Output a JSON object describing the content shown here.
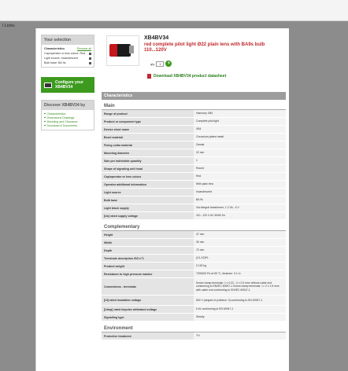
{
  "top_links": "l Links",
  "selection": {
    "title": "Your selection",
    "header_label": "Characteristics",
    "remove_all": "Remove all",
    "items": [
      "Cap/operator or lens colour: Red",
      "Light source: Incandescent",
      "Bulb base: BA 9s"
    ]
  },
  "config_button": "Configure your XB4BV34",
  "discover": {
    "title": "Discover XB4BV34 by",
    "links": [
      "Characteristics",
      "Dimensions Drawings",
      "Mounting and Clearance",
      "Download & Documents"
    ]
  },
  "product": {
    "name": "XB4BV34",
    "description": "red complete pilot light Ø22 plain lens with BA9s bulb 110...120V",
    "qty_label": "qty",
    "qty_value": "1",
    "add_symbol": "+",
    "download_text": "Download XB4BV34 product datasheet"
  },
  "specs": {
    "header": "Characteristics",
    "sections": [
      {
        "title": "Main",
        "rows": [
          {
            "label": "Range of product",
            "value": "Harmony XB4"
          },
          {
            "label": "Product or component type",
            "value": "Complete pilot light"
          },
          {
            "label": "Device short name",
            "value": "XB4"
          },
          {
            "label": "Bezel material",
            "value": "Chromium plated metal"
          },
          {
            "label": "Fixing collar material",
            "value": "Zamak"
          },
          {
            "label": "Mounting diameter",
            "value": "22 mm"
          },
          {
            "label": "Sale per indivisible quantity",
            "value": "1"
          },
          {
            "label": "Shape of signaling unit head",
            "value": "Round"
          },
          {
            "label": "Cap/operator or lens colour",
            "value": "Red"
          },
          {
            "label": "Operator additional information",
            "value": "With plain lens"
          },
          {
            "label": "Light source",
            "value": "Incandescent"
          },
          {
            "label": "Bulb base",
            "value": "BA 9s"
          },
          {
            "label": "Light block supply",
            "value": "Via integral transformer, 1.2 VA - 6 V"
          },
          {
            "label": "[Us] rated supply voltage",
            "value": "110...120 V AC 50/60 Hz"
          }
        ]
      },
      {
        "title": "Complementary",
        "rows": [
          {
            "label": "Height",
            "value": "47 mm"
          },
          {
            "label": "Width",
            "value": "30 mm"
          },
          {
            "label": "Depth",
            "value": "70 mm"
          },
          {
            "label": "Terminals description ISO n°1",
            "value": "(X1-X2)PL"
          },
          {
            "label": "Product weight",
            "value": "0.152 kg"
          },
          {
            "label": "Resistance to high pressure washer",
            "value": "7000000 Pa at 55 °C, distance: 0.1 m"
          },
          {
            "label": "Connections - terminals",
            "value": "Screw clamp terminals: 1 x 0.22...2 x 2.5 mm² without cable end conforming to EN/IEC 60947-1 Screw clamp terminals: <= 2 x 1.5 mm² with cable end conforming to EN/IEC 60947-1"
          },
          {
            "label": "[Ui] rated insulation voltage",
            "value": "600 V (degree of pollution: 3) conforming to EN 60947-1"
          },
          {
            "label": "[Uimp] rated impulse withstand voltage",
            "value": "6 kV conforming to EN 60947-1"
          },
          {
            "label": "Signalling type",
            "value": "Steady"
          }
        ]
      },
      {
        "title": "Environment",
        "rows": [
          {
            "label": "Protective treatment",
            "value": "TH"
          }
        ]
      }
    ]
  }
}
